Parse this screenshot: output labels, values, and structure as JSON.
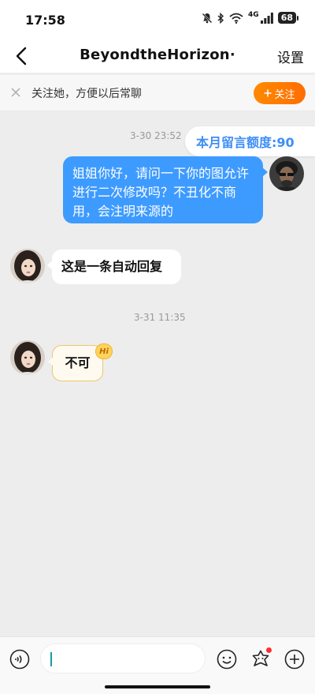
{
  "status": {
    "time": "17:58",
    "network": "4G",
    "battery": "68"
  },
  "nav": {
    "title": "BeyondtheHorizon·",
    "settings_label": "设置"
  },
  "follow_bar": {
    "text": "关注她，方便以后常聊",
    "button_label": "关注",
    "button_color": "#ff7a00"
  },
  "quota": {
    "text": "本月留言额度:90"
  },
  "messages": [
    {
      "timestamp": "3-30 23:52",
      "sender": "self",
      "text": "姐姐你好，请问一下你的图允许进行二次修改吗？不丑化不商用，会注明来源的"
    },
    {
      "sender": "other",
      "text": "这是一条自动回复"
    },
    {
      "timestamp": "3-31 11:35",
      "sender": "other",
      "text": "不可",
      "badge": "Hi"
    }
  ],
  "input": {
    "placeholder": ""
  },
  "icons": [
    "back-icon",
    "close-icon",
    "plus-icon",
    "voice-icon",
    "emoji-icon",
    "sticker-icon",
    "add-icon"
  ],
  "colors": {
    "outgoing_bubble": "#3d9bff",
    "quota_text": "#3d8ef6",
    "background": "#ededed"
  }
}
